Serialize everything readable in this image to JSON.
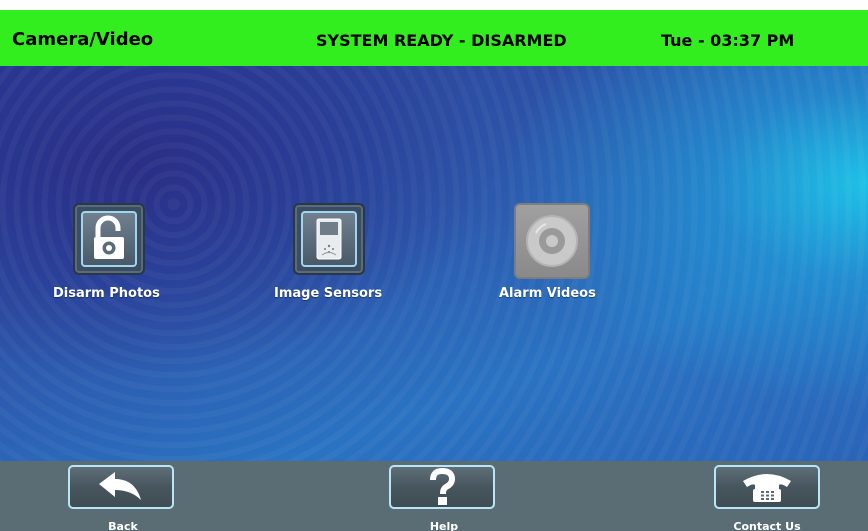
{
  "header": {
    "title": "Camera/Video",
    "status": "SYSTEM READY - DISARMED",
    "clock": "Tue - 03:37 PM"
  },
  "tiles": [
    {
      "label": "Disarm Photos",
      "icon": "unlocked-padlock-icon"
    },
    {
      "label": "Image Sensors",
      "icon": "image-sensor-icon"
    },
    {
      "label": "Alarm Videos",
      "icon": "video-disc-icon"
    }
  ],
  "footer": {
    "back_label": "Back",
    "help_label": "Help",
    "contact_label": "Contact Us"
  },
  "colors": {
    "header_bg": "#33ee1e",
    "footer_bg": "#5b6d74",
    "button_border": "#b8e6f6"
  }
}
